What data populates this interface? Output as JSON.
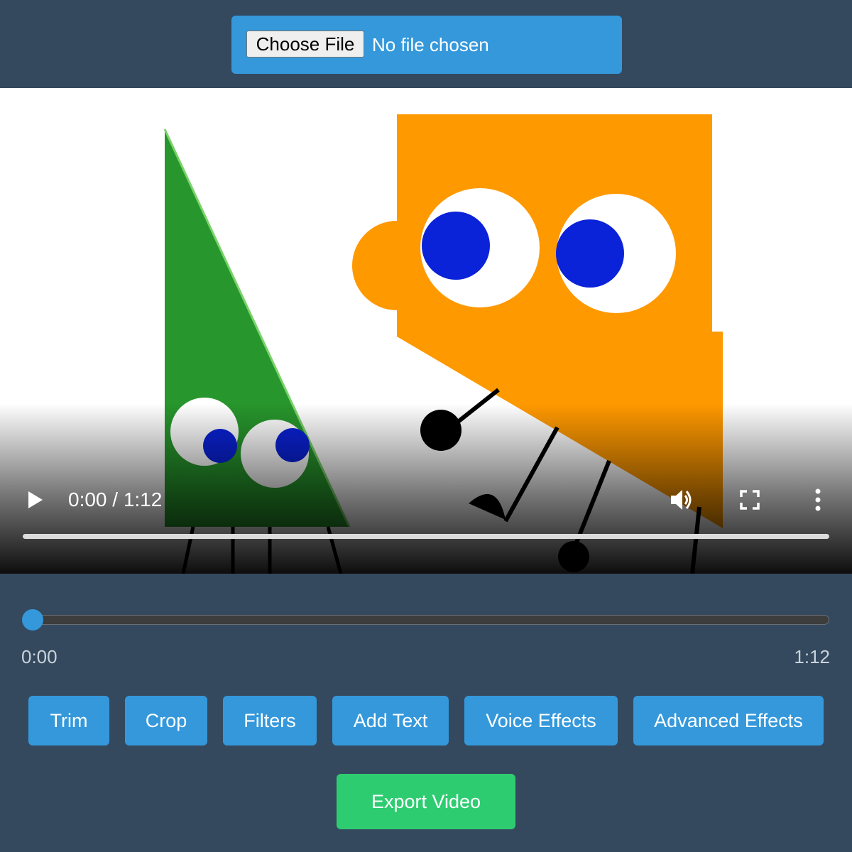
{
  "file_input": {
    "button_label": "Choose File",
    "status": "No file chosen"
  },
  "player": {
    "time_display": "0:00 / 1:12",
    "progress": 0,
    "icons": [
      "play-icon",
      "volume-icon",
      "fullscreen-icon",
      "more-vert-icon"
    ]
  },
  "timeline": {
    "position": 0,
    "start_label": "0:00",
    "end_label": "1:12"
  },
  "toolbar": {
    "trim": "Trim",
    "crop": "Crop",
    "filters": "Filters",
    "add_text": "Add Text",
    "voice_effects": "Voice Effects",
    "advanced_effects": "Advanced Effects"
  },
  "export_label": "Export Video",
  "colors": {
    "background": "#34495e",
    "accent": "#3498db",
    "export": "#2ecc71",
    "character_triangle": "#27962c",
    "character_orange": "#ff9900",
    "pupil": "#0a22d8"
  }
}
